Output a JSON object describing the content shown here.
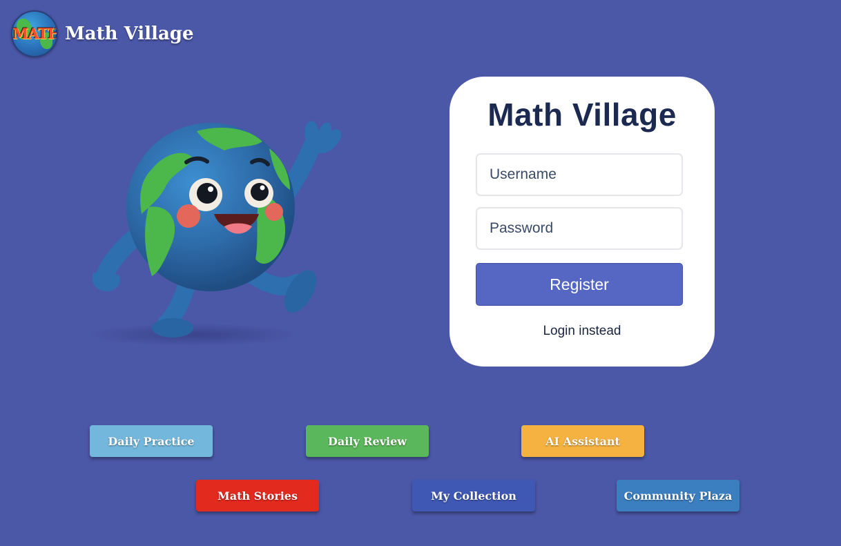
{
  "header": {
    "logo_text": "MATH",
    "brand_title": "Math Village"
  },
  "login_card": {
    "title": "Math Village",
    "username_placeholder": "Username",
    "password_placeholder": "Password",
    "register_label": "Register",
    "login_link_label": "Login instead"
  },
  "features": [
    {
      "label": "Daily Practice",
      "color": "#73b7dc"
    },
    {
      "label": "Daily Review",
      "color": "#5bb75b"
    },
    {
      "label": "AI Assistant",
      "color": "#f5b240"
    },
    {
      "label": "Math Stories",
      "color": "#e22a1e"
    },
    {
      "label": "My Collection",
      "color": "#3f58b4"
    },
    {
      "label": "Community Plaza",
      "color": "#3b7fc0"
    }
  ],
  "colors": {
    "background": "#4b57a7",
    "card": "#ffffff",
    "primary_button": "#5567c3",
    "title_text": "#1c2a52"
  },
  "icons": {
    "logo": "globe-math-logo-icon",
    "mascot": "waving-earth-mascot-icon"
  }
}
